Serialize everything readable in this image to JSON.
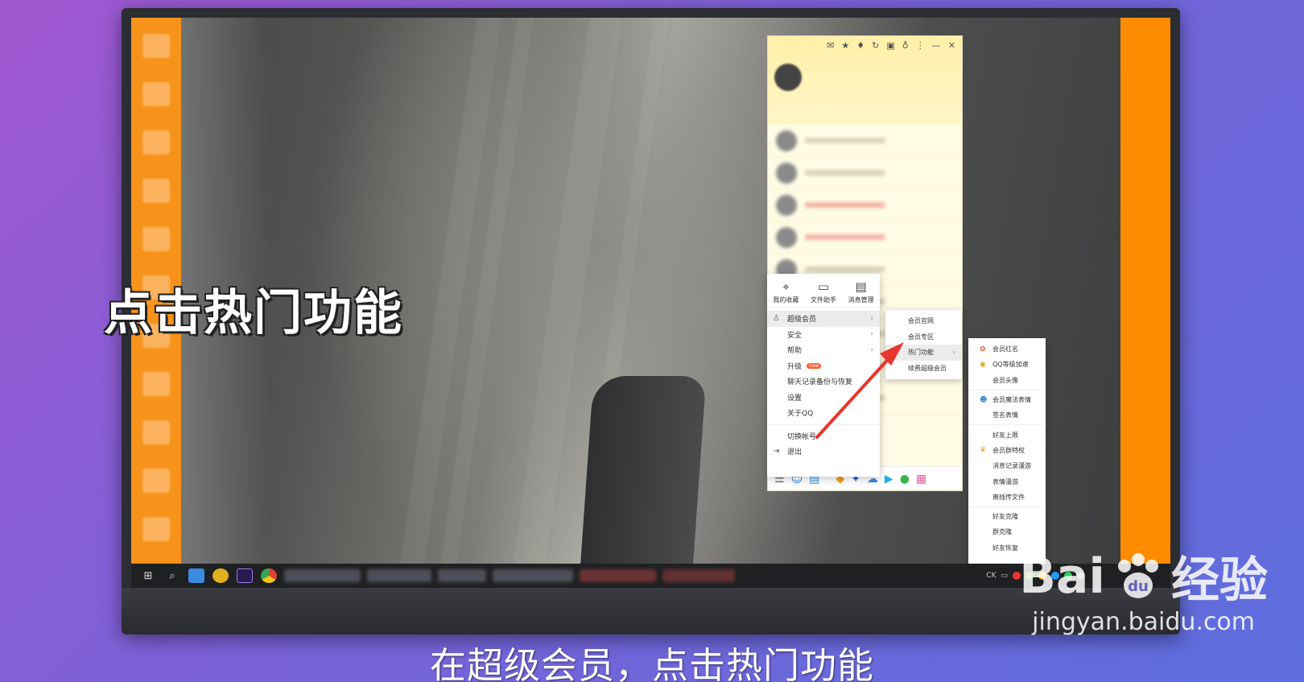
{
  "overlay_title": "点击热门功能",
  "caption": "在超级会员，点击热门功能",
  "watermark": {
    "brand_left": "Bai",
    "brand_right": "经验",
    "url": "jingyan.baidu.com"
  },
  "menu": {
    "tools": [
      {
        "label": "我的收藏",
        "icon": "bookmark-icon"
      },
      {
        "label": "文件助手",
        "icon": "folder-icon"
      },
      {
        "label": "消息管理",
        "icon": "message-icon"
      }
    ],
    "items": [
      {
        "label": "超级会员",
        "arrow": true
      },
      {
        "label": "安全",
        "arrow": true
      },
      {
        "label": "帮助",
        "arrow": true
      },
      {
        "label": "升级",
        "badge": "new"
      },
      {
        "label": "聊天记录备份与恢复"
      },
      {
        "label": "设置"
      },
      {
        "label": "关于QQ"
      },
      {
        "label": "切换帐号"
      },
      {
        "label": "退出"
      }
    ]
  },
  "submenu_vip": [
    "会员官网",
    "会员专区",
    "热门功能",
    "续费超级会员"
  ],
  "submenu_hot": [
    [
      "会员红名",
      "QQ等级加速",
      "会员头像"
    ],
    [
      "会员魔法表情",
      "签名表情"
    ],
    [
      "好友上限",
      "会员群特权",
      "消息记录漫游",
      "表情漫游",
      "离线传文件"
    ],
    [
      "好友克隆",
      "群克隆",
      "好友恢复"
    ]
  ],
  "tray": {
    "ime": "CK"
  },
  "colors": {
    "accent_orange": "#f7931a",
    "arrow_red": "#e8352d",
    "qq_yellow": "#fff6c8"
  }
}
